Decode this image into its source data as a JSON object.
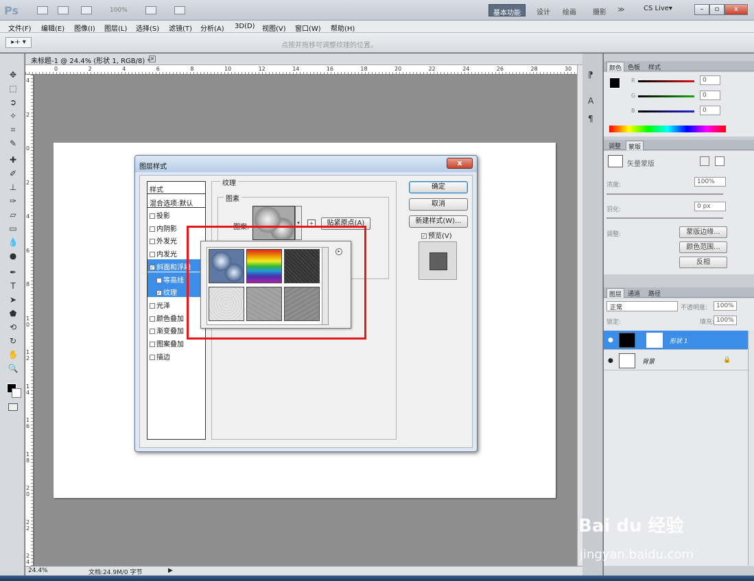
{
  "app": {
    "logo": "Ps",
    "zoom_display": "100%",
    "workspaces": [
      "基本功能",
      "设计",
      "绘画",
      "摄影",
      "≫"
    ],
    "cs_live": "CS Live▾"
  },
  "menu": [
    "文件(F)",
    "编辑(E)",
    "图像(I)",
    "图层(L)",
    "选择(S)",
    "滤镜(T)",
    "分析(A)",
    "3D(D)",
    "视图(V)",
    "窗口(W)",
    "帮助(H)"
  ],
  "options_bar": {
    "tool_label": "▸+ ▾",
    "hint": "点按并拖移可调整纹理的位置。"
  },
  "document": {
    "tab_title": "未标题-1 @ 24.4% (形状 1, RGB/8) *",
    "ruler_h": [
      "0",
      "2",
      "4",
      "6",
      "8",
      "10",
      "12",
      "14",
      "16",
      "18",
      "20",
      "22",
      "24",
      "26",
      "28",
      "30"
    ],
    "ruler_v": [
      "4",
      "2",
      "0",
      "2",
      "4",
      "6",
      "8",
      "1 0",
      "1 2",
      "1 4",
      "1 6",
      "1 8",
      "2 0",
      "2 2",
      "2 4"
    ],
    "status_zoom": "24.4%",
    "status_doc": "文档:24.9M/0 字节"
  },
  "dialog": {
    "title": "图层样式",
    "close": "x",
    "styles_header": "样式",
    "blend_options": "混合选项:默认",
    "style_items": [
      {
        "label": "投影",
        "checked": false,
        "sub": false,
        "selected": false
      },
      {
        "label": "内阴影",
        "checked": false,
        "sub": false,
        "selected": false
      },
      {
        "label": "外发光",
        "checked": false,
        "sub": false,
        "selected": false
      },
      {
        "label": "内发光",
        "checked": false,
        "sub": false,
        "selected": false
      },
      {
        "label": "斜面和浮雕",
        "checked": true,
        "sub": false,
        "selected": true
      },
      {
        "label": "等高线",
        "checked": false,
        "sub": true,
        "selected": true
      },
      {
        "label": "纹理",
        "checked": true,
        "sub": true,
        "selected": true
      },
      {
        "label": "光泽",
        "checked": false,
        "sub": false,
        "selected": false
      },
      {
        "label": "颜色叠加",
        "checked": false,
        "sub": false,
        "selected": false
      },
      {
        "label": "渐变叠加",
        "checked": false,
        "sub": false,
        "selected": false
      },
      {
        "label": "图案叠加",
        "checked": false,
        "sub": false,
        "selected": false
      },
      {
        "label": "描边",
        "checked": false,
        "sub": false,
        "selected": false
      }
    ],
    "texture_group_title": "纹理",
    "pattern_group_title": "图素",
    "pattern_label": "图案:",
    "snap_button": "贴紧原点(A)",
    "ok_button": "确定",
    "cancel_button": "取消",
    "new_style_button": "新建样式(W)...",
    "preview_label": "预览(V)",
    "preview_checked": true
  },
  "picker": {
    "swatches": [
      "bubbles",
      "rainbow",
      "dark-noise",
      "white-paper",
      "gray-paper",
      "gray-texture"
    ]
  },
  "panels": {
    "color_tabs": [
      "颜色",
      "色板",
      "样式"
    ],
    "rgb": [
      {
        "label": "R",
        "value": "0",
        "color": "#d11"
      },
      {
        "label": "G",
        "value": "0",
        "color": "#1a1"
      },
      {
        "label": "B",
        "value": "0",
        "color": "#22c"
      }
    ],
    "adjust_tabs": [
      "调整",
      "蒙版"
    ],
    "mask_title": "矢量蒙版",
    "density_label": "浓度:",
    "density_value": "100%",
    "feather_label": "羽化:",
    "feather_value": "0 px",
    "refine_label": "调整:",
    "mask_edge": "蒙版边缘...",
    "color_range": "颜色范围...",
    "invert": "反相",
    "layers_tabs": [
      "图层",
      "通道",
      "路径"
    ],
    "blend_mode": "正常",
    "opacity_label": "不透明度:",
    "opacity_value": "100%",
    "lock_label": "锁定:",
    "fill_label": "填充:",
    "fill_value": "100%",
    "layers": [
      {
        "name": "形状 1",
        "selected": true
      },
      {
        "name": "背景",
        "selected": false
      }
    ]
  },
  "watermark": {
    "brand": "Bai du 经验",
    "url": "jingyan.baidu.com"
  }
}
